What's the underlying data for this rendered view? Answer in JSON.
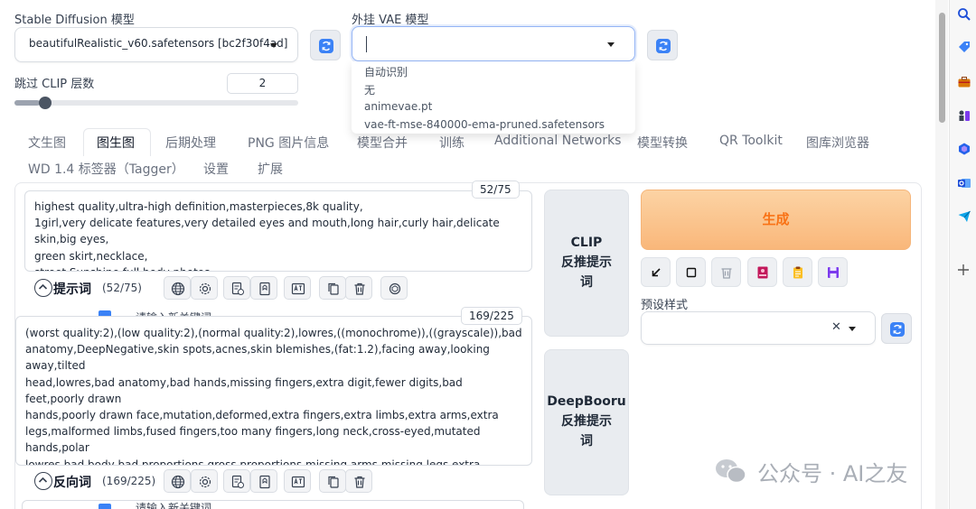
{
  "model": {
    "label": "Stable Diffusion 模型",
    "value": "beautifulRealistic_v60.safetensors [bc2f30f4ad]"
  },
  "vae": {
    "label": "外挂 VAE 模型",
    "value": "",
    "options": [
      "自动识别",
      "无",
      "animevae.pt",
      "vae-ft-mse-840000-ema-pruned.safetensors"
    ]
  },
  "clip_skip": {
    "label": "跳过 CLIP 层数",
    "value": "2",
    "fraction": 0.04
  },
  "tabs": [
    {
      "label": "文生图",
      "active": false
    },
    {
      "label": "图生图",
      "active": true
    },
    {
      "label": "后期处理",
      "active": false
    },
    {
      "label": "PNG 图片信息",
      "active": false
    },
    {
      "label": "模型合并",
      "active": false
    },
    {
      "label": "训练",
      "active": false
    },
    {
      "label": "Additional Networks",
      "active": false
    },
    {
      "label": "模型转换",
      "active": false
    },
    {
      "label": "QR Toolkit",
      "active": false
    },
    {
      "label": "图库浏览器",
      "active": false
    },
    {
      "label": "WD 1.4 标签器（Tagger）",
      "active": false
    },
    {
      "label": "设置",
      "active": false
    },
    {
      "label": "扩展",
      "active": false
    }
  ],
  "prompt": {
    "counter": "52/75",
    "text": "highest quality,ultra-high definition,masterpieces,8k quality,\n1girl,very delicate features,very detailed eyes and mouth,long hair,curly hair,delicate skin,big eyes,\ngreen skirt,necklace,\nstreet,Sunshine,full body photos,",
    "section_label": "提示词",
    "section_count": "(52/75)",
    "partial_text": "请输入新关键词"
  },
  "negative": {
    "counter": "169/225",
    "text": "(worst quality:2),(low quality:2),(normal quality:2),lowres,((monochrome)),((grayscale)),bad\nanatomy,DeepNegative,skin spots,acnes,skin blemishes,(fat:1.2),facing away,looking away,tilted\nhead,lowres,bad anatomy,bad hands,missing fingers,extra digit,fewer digits,bad feet,poorly drawn\nhands,poorly drawn face,mutation,deformed,extra fingers,extra limbs,extra arms,extra\nlegs,malformed limbs,fused fingers,too many fingers,long neck,cross-eyed,mutated hands,polar\nlowres,bad body,bad proportions,gross proportions,missing arms,missing legs,extra digit,extra\narms,extra leg,extra foot,teethcroppe,signature,watermark,username,blurry,cropped,jpeg\nartifacts,text,error,",
    "section_label": "反向词",
    "section_count": "(169/225)",
    "partial_text": "请输入新关键词"
  },
  "interrogate": {
    "clip": "CLIP\n反推提示\n词",
    "deepbooru": "DeepBooru\n反推提示\n词"
  },
  "generate_label": "生成",
  "styles": {
    "label": "预设样式",
    "clear_symbol": "✕"
  },
  "watermark": "公众号 · AI之友",
  "colors": {
    "accent": "#f97316",
    "refresh": "#3b82f6"
  }
}
